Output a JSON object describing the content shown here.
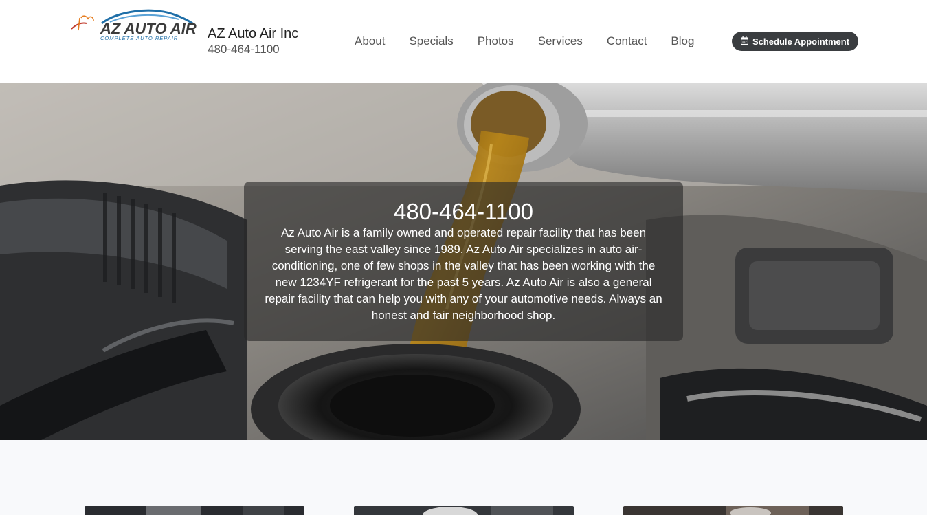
{
  "header": {
    "logo": {
      "text": "AZ AUTO AIR",
      "tagline": "COMPLETE AUTO REPAIR"
    },
    "business_name": "AZ Auto Air Inc",
    "phone": "480-464-1100",
    "nav": [
      {
        "label": "About"
      },
      {
        "label": "Specials"
      },
      {
        "label": "Photos"
      },
      {
        "label": "Services"
      },
      {
        "label": "Contact"
      },
      {
        "label": "Blog"
      }
    ],
    "cta": {
      "label": "Schedule Appointment",
      "icon": "calendar-icon"
    }
  },
  "hero": {
    "phone": "480-464-1100",
    "description": "Az Auto Air is a family owned and operated repair facility that has been serving the east valley since 1989. Az Auto Air specializes in auto air-conditioning, one of few shops in the valley that has been working with the new 1234YF refrigerant for the past 5 years. Az Auto Air is also a general repair facility that can help you with any of your automotive needs. Always an honest and fair neighborhood shop."
  },
  "colors": {
    "cta_background": "#3a3d40",
    "logo_blue": "#1f6fa8",
    "page_background": "#f8f9fb"
  }
}
